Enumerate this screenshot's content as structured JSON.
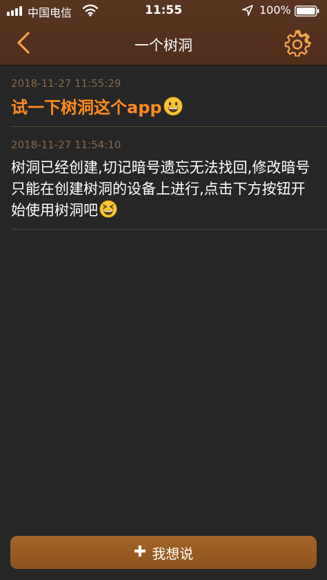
{
  "status_bar": {
    "carrier": "中国电信",
    "time": "11:55",
    "battery_percent": "100%",
    "signal_bars": 4,
    "icons": [
      "signal-icon",
      "wifi-icon",
      "location-arrow-icon",
      "battery-icon"
    ]
  },
  "nav": {
    "title": "一个树洞",
    "back_icon": "chevron-left-icon",
    "settings_icon": "gear-icon"
  },
  "posts": [
    {
      "time": "2018-11-27 11:55:29",
      "text": "试一下树洞这个app",
      "emoji": "grinning-face-icon"
    },
    {
      "time": "2018-11-27 11:54:10",
      "text": "树洞已经创建,切记暗号遗忘无法找回,修改暗号只能在创建树洞的设备上进行,点击下方按钮开始使用树洞吧",
      "emoji": "laughing-face-icon"
    }
  ],
  "bottom_button": {
    "label": "我想说",
    "icon": "plus-icon"
  },
  "colors": {
    "header_brown": "#5a3521",
    "background": "#262626",
    "accent_orange": "#ff8b1e",
    "timestamp": "#86674a",
    "button_brown": "#a46426"
  }
}
